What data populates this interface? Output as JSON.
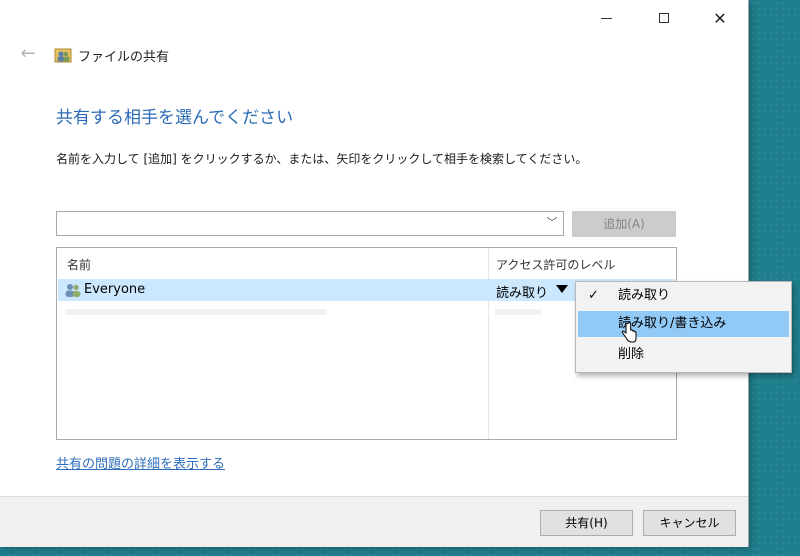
{
  "window": {
    "header_title": "ファイルの共有",
    "caption": {
      "minimize": "",
      "maximize": "",
      "close": "✕"
    }
  },
  "heading": "共有する相手を選んでください",
  "instruction": "名前を入力して [追加] をクリックするか、または、矢印をクリックして相手を検索してください。",
  "name_input": {
    "value": "",
    "placeholder": ""
  },
  "add_button": "追加(A)",
  "list": {
    "columns": [
      "名前",
      "アクセス許可のレベル"
    ],
    "rows": [
      {
        "name": "Everyone",
        "access": "読み取り"
      }
    ]
  },
  "permission_menu": {
    "items": [
      {
        "label": "読み取り",
        "checked": true
      },
      {
        "label": "読み取り/書き込み",
        "hovered": true
      },
      {
        "label": "削除"
      }
    ]
  },
  "problems_link": "共有の問題の詳細を表示する",
  "buttons": {
    "share": "共有(H)",
    "cancel": "キャンセル"
  },
  "colors": {
    "heading": "#2b6bb6",
    "selection": "#cce8ff",
    "menu_hover": "#91c9f7",
    "link": "#2f6ebb"
  }
}
